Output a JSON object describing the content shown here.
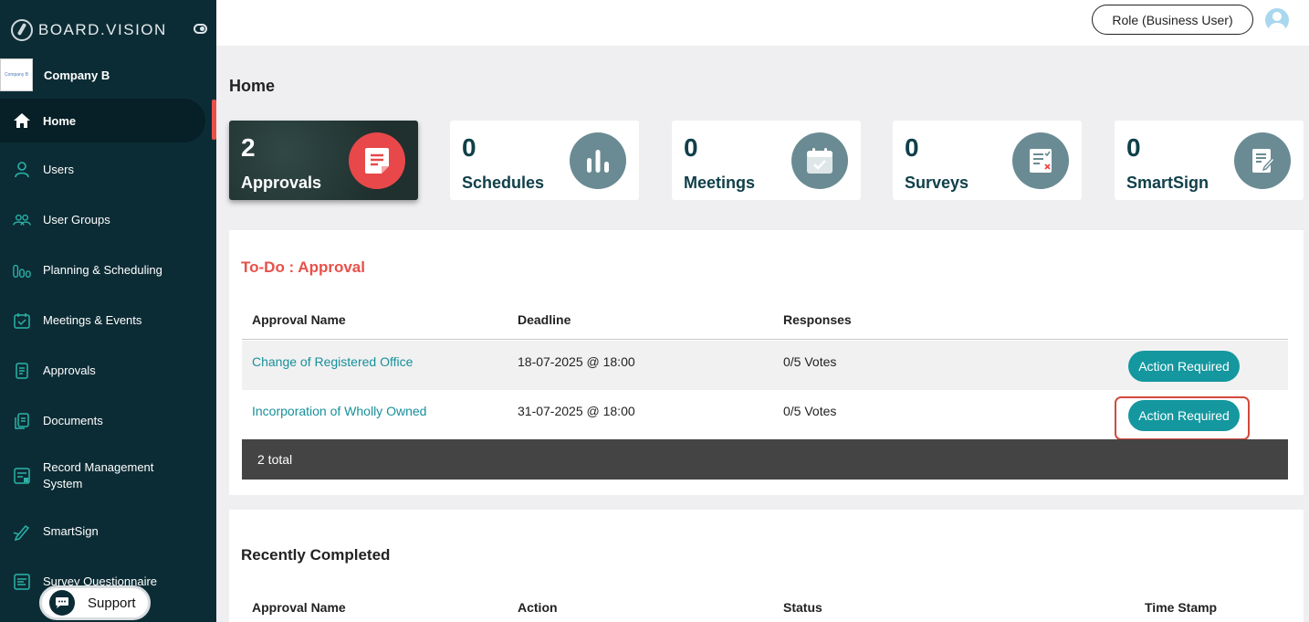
{
  "brand": {
    "name": "BOARD.VISION"
  },
  "company": {
    "logo_text": "Company B",
    "name": "Company B"
  },
  "sidebar": {
    "items": [
      {
        "label": "Home",
        "icon": "home-icon"
      },
      {
        "label": "Users",
        "icon": "user-icon"
      },
      {
        "label": "User Groups",
        "icon": "user-group-icon"
      },
      {
        "label": "Planning & Scheduling",
        "icon": "bar-chart-icon"
      },
      {
        "label": "Meetings & Events",
        "icon": "calendar-check-icon"
      },
      {
        "label": "Approvals",
        "icon": "document-icon"
      },
      {
        "label": "Documents",
        "icon": "documents-icon"
      },
      {
        "label": "Record Management",
        "label2": "System",
        "icon": "record-icon"
      },
      {
        "label": "SmartSign",
        "icon": "pen-icon"
      },
      {
        "label": "Survey Questionnaire",
        "icon": "list-icon"
      }
    ],
    "support_label": "Support"
  },
  "header": {
    "role_label": "Role (Business User)"
  },
  "page": {
    "title": "Home"
  },
  "stats": [
    {
      "count": "2",
      "label": "Approvals",
      "icon": "approval-doc-icon"
    },
    {
      "count": "0",
      "label": "Schedules",
      "icon": "bar-chart-icon"
    },
    {
      "count": "0",
      "label": "Meetings",
      "icon": "calendar-icon"
    },
    {
      "count": "0",
      "label": "Surveys",
      "icon": "survey-icon"
    },
    {
      "count": "0",
      "label": "SmartSign",
      "icon": "sign-icon"
    }
  ],
  "todo": {
    "title": "To-Do : Approval",
    "columns": [
      "Approval Name",
      "Deadline",
      "Responses"
    ],
    "rows": [
      {
        "name": "Change of Registered Office",
        "deadline": "18-07-2025 @ 18:00",
        "responses": "0/5 Votes",
        "action": "Action Required"
      },
      {
        "name": "Incorporation of Wholly Owned",
        "deadline": "31-07-2025 @ 18:00",
        "responses": "0/5 Votes",
        "action": "Action Required"
      }
    ],
    "total": "2 total"
  },
  "recent": {
    "title": "Recently Completed",
    "columns": [
      "Approval Name",
      "Action",
      "Status",
      "Time Stamp"
    ]
  },
  "colors": {
    "sidebar": "#0c2c35",
    "accent": "#14979f",
    "alert": "#e8504a"
  }
}
